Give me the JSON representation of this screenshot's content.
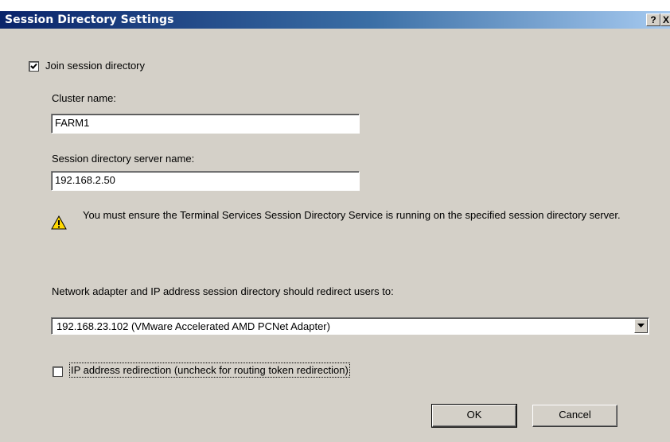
{
  "window": {
    "title": "Session Directory Settings",
    "help_glyph": "?",
    "close_glyph": "X"
  },
  "join": {
    "label": "Join session directory",
    "checked": true
  },
  "cluster": {
    "label": "Cluster name:",
    "value": "FARM1"
  },
  "server": {
    "label": "Session directory server name:",
    "value": "192.168.2.50"
  },
  "warning": {
    "icon": "warning-icon",
    "text": "You must ensure the Terminal Services Session Directory Service is running on the specified session directory server."
  },
  "network": {
    "label": "Network adapter and IP address session directory should redirect users to:",
    "selected": "192.168.23.102 (VMware Accelerated AMD PCNet Adapter)"
  },
  "ip_redirect": {
    "label": "IP address redirection (uncheck for routing token redirection)",
    "checked": false
  },
  "buttons": {
    "ok": "OK",
    "cancel": "Cancel"
  },
  "colors": {
    "titlebar_start": "#0a246a",
    "titlebar_end": "#a6caf0",
    "dialog_bg": "#d4d0c8",
    "warning_yellow": "#ffd800"
  }
}
